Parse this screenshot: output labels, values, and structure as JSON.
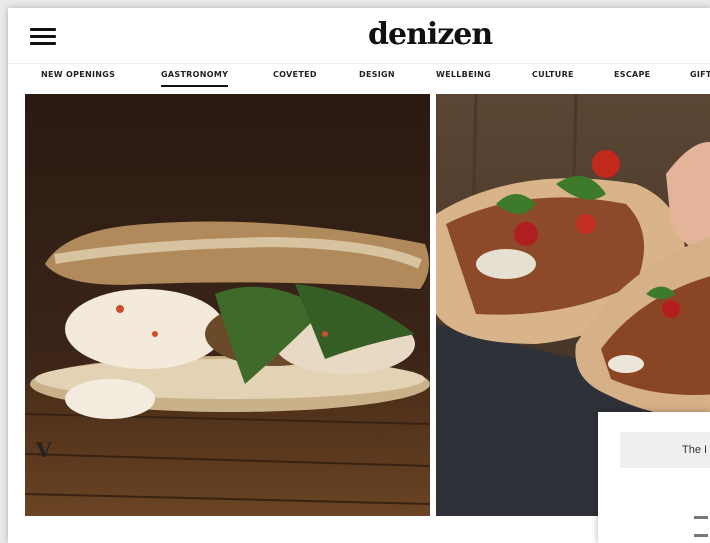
{
  "header": {
    "logo": "denizen",
    "menu_icon": "hamburger-menu-icon"
  },
  "nav": {
    "items": [
      {
        "label": "NEW OPENINGS",
        "active": false
      },
      {
        "label": "GASTRONOMY",
        "active": true
      },
      {
        "label": "COVETED",
        "active": false
      },
      {
        "label": "DESIGN",
        "active": false
      },
      {
        "label": "WELLBEING",
        "active": false
      },
      {
        "label": "CULTURE",
        "active": false
      },
      {
        "label": "ESCAPE",
        "active": false
      },
      {
        "label": "GIFT",
        "active": false
      }
    ]
  },
  "overlay": {
    "letter": "V",
    "title": "The I"
  },
  "colors": {
    "background": "#ffffff",
    "text": "#111111"
  }
}
